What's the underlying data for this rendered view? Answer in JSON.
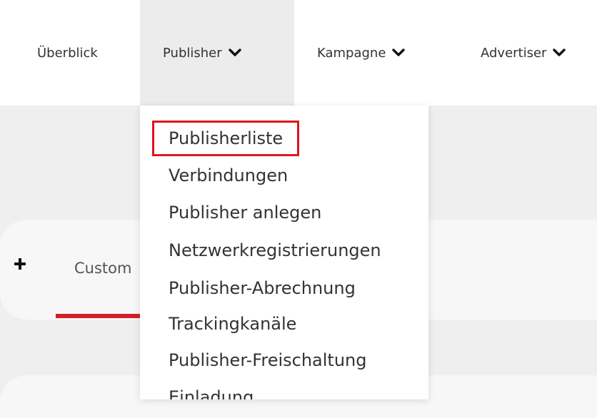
{
  "nav": {
    "items": [
      {
        "label": "Überblick"
      },
      {
        "label": "Publisher"
      },
      {
        "label": "Kampagne"
      },
      {
        "label": "Advertiser"
      }
    ]
  },
  "dropdown": {
    "items": [
      {
        "label": "Publisherliste"
      },
      {
        "label": "Verbindungen"
      },
      {
        "label": "Publisher anlegen"
      },
      {
        "label": "Netzwerkregistrierungen"
      },
      {
        "label": "Publisher-Abrechnung"
      },
      {
        "label": "Trackingkanäle"
      },
      {
        "label": "Publisher-Freischaltung"
      },
      {
        "label": "Einladung"
      }
    ]
  },
  "card": {
    "tab_label": "Custom"
  },
  "colors": {
    "accent": "#d31f26",
    "highlight_border": "#e0141e",
    "nav_active_bg": "#ececec"
  },
  "icons": {
    "chevron": "chevron-down-icon",
    "add": "plus-icon"
  }
}
